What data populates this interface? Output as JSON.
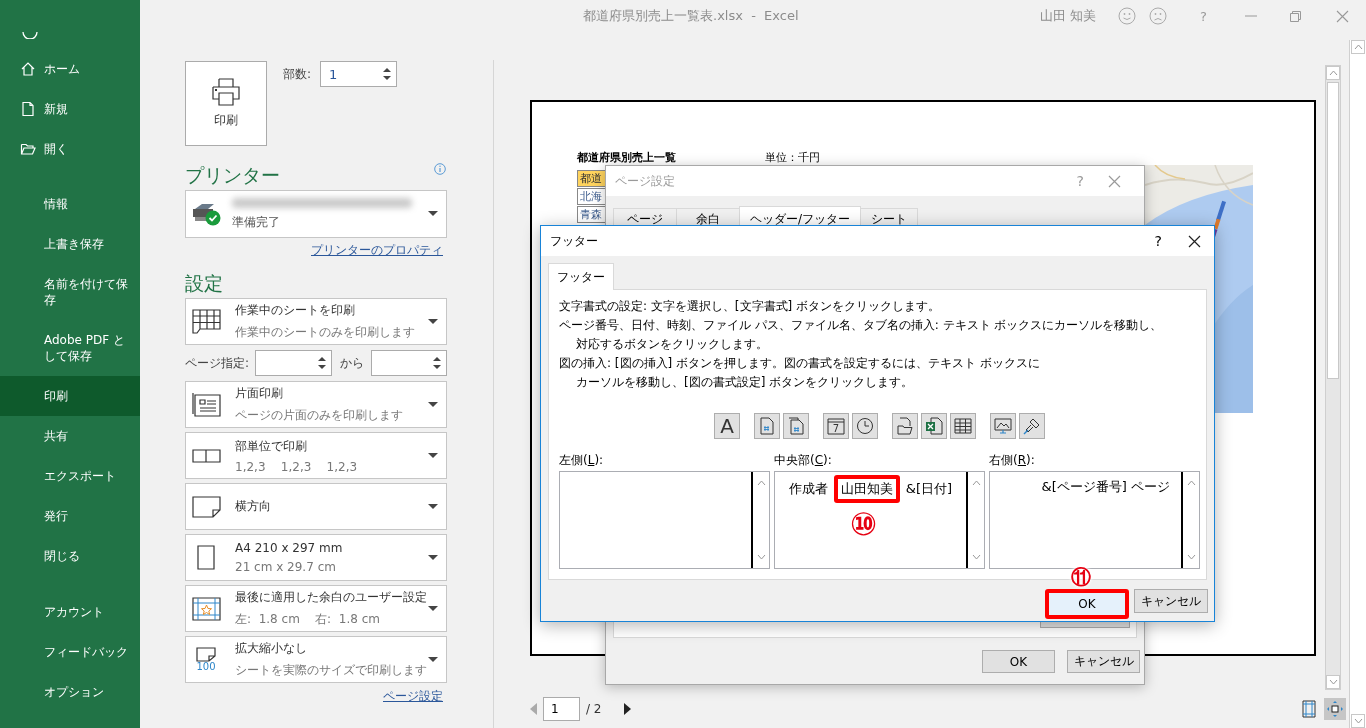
{
  "window": {
    "title": "都道府県別売上一覧表.xlsx  -  Excel",
    "user": "山田 知美",
    "help": "?"
  },
  "sidebar": {
    "sections": [
      [
        {
          "label": "ホーム",
          "selected": false
        },
        {
          "label": "新規",
          "selected": false
        },
        {
          "label": "開く",
          "selected": false
        }
      ],
      [
        {
          "label": "情報",
          "selected": false
        },
        {
          "label": "上書き保存",
          "selected": false
        },
        {
          "label": "名前を付けて保存",
          "selected": false
        },
        {
          "label": "Adobe PDF として保存",
          "selected": false
        },
        {
          "label": "印刷",
          "selected": true
        },
        {
          "label": "共有",
          "selected": false
        },
        {
          "label": "エクスポート",
          "selected": false
        },
        {
          "label": "発行",
          "selected": false
        },
        {
          "label": "閉じる",
          "selected": false
        }
      ],
      [
        {
          "label": "アカウント",
          "selected": false
        },
        {
          "label": "フィードバック",
          "selected": false
        },
        {
          "label": "オプション",
          "selected": false
        }
      ]
    ]
  },
  "print": {
    "print_button": "印刷",
    "copies_label": "部数:",
    "copies": "1",
    "printer_heading": "プリンター",
    "printer_status": "準備完了",
    "printer_properties": "プリンターのプロパティ",
    "settings_heading": "設定",
    "settings": [
      {
        "kind": "dropdown",
        "title": "作業中のシートを印刷",
        "subtitle": "作業中のシートのみを印刷します"
      },
      {
        "kind": "range",
        "label": "ページ指定:",
        "between": "から"
      },
      {
        "kind": "dropdown",
        "title": "片面印刷",
        "subtitle": "ページの片面のみを印刷します"
      },
      {
        "kind": "dropdown",
        "title": "部単位で印刷",
        "subtitle": "1,2,3    1,2,3    1,2,3"
      },
      {
        "kind": "dropdown",
        "title": "横方向"
      },
      {
        "kind": "dropdown",
        "title": "A4 210 x 297 mm",
        "subtitle": "21 cm x 29.7 cm"
      },
      {
        "kind": "dropdown",
        "title": "最後に適用した余白のユーザー設定",
        "subtitle": "左:  1.8 cm    右:  1.8 cm"
      },
      {
        "kind": "dropdown",
        "icon_label": "100",
        "title": "拡大縮小なし",
        "subtitle": "シートを実際のサイズで印刷します"
      }
    ],
    "page_setup_link": "ページ設定"
  },
  "preview": {
    "sheet_title": "都道府県別売上一覧",
    "unit": "単位：千円",
    "cells": [
      {
        "text": "都道",
        "header": true
      },
      {
        "text": "北海",
        "header": false
      },
      {
        "text": "青森",
        "header": false
      }
    ],
    "page_current": "1",
    "page_total": "/ 2"
  },
  "page_setup": {
    "title": "ページ設定",
    "help": "?",
    "tabs": [
      {
        "label": "ページ",
        "selected": false
      },
      {
        "label": "余白",
        "selected": false
      },
      {
        "label": "ヘッダー/フッター",
        "selected": true
      },
      {
        "label": "シート",
        "selected": false
      }
    ],
    "buttons": [
      "OK",
      "キャンセル"
    ]
  },
  "footer": {
    "title": "フッター",
    "help": "?",
    "tab": "フッター",
    "instructions": [
      [
        "文字書式の設定: 文字を選択し、[文字書式] ボタンをクリックします。"
      ],
      [
        "ページ番号、日付、時刻、ファイル パス、ファイル名、タブ名の挿入: テキスト ボックスにカーソルを移動し、",
        "対応するボタンをクリックします。"
      ],
      [
        "図の挿入: [図の挿入] ボタンを押します。図の書式を設定するには、テキスト ボックスに",
        "カーソルを移動し、[図の書式設定] ボタンをクリックします。"
      ]
    ],
    "toolbar_labels": [
      "A",
      "7"
    ],
    "sections": [
      {
        "label_before": "左側(",
        "access_key": "L",
        "label_after": "):"
      },
      {
        "label_before": "中央部(",
        "access_key": "C",
        "label_after": "):",
        "parts": [
          {
            "text": "作成者",
            "highlight": false
          },
          {
            "text": "山田知美",
            "highlight": true
          },
          {
            "text": "&[日付]",
            "highlight": false
          }
        ]
      },
      {
        "label_before": "右側(",
        "access_key": "R",
        "label_after": "):",
        "parts": [
          {
            "text": "&[ページ番号] ページ",
            "highlight": false
          }
        ]
      }
    ],
    "buttons": [
      {
        "label": "OK",
        "highlight": true
      },
      {
        "label": "キャンセル",
        "highlight": false
      }
    ]
  },
  "annotations": [
    "⑩",
    "⑪"
  ]
}
